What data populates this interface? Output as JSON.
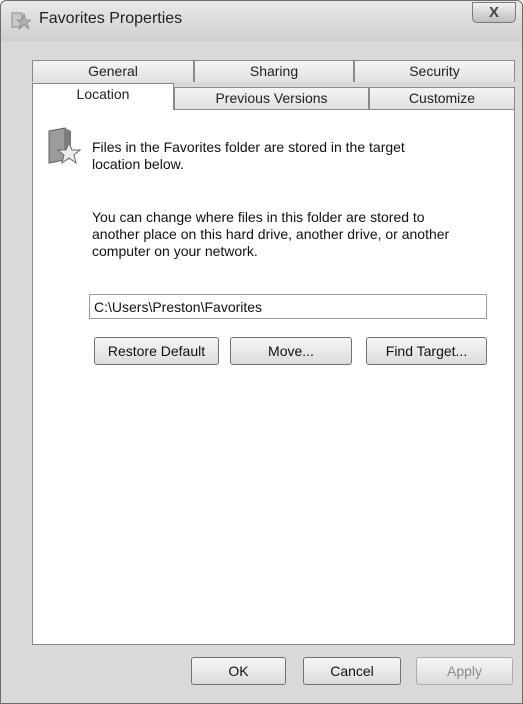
{
  "window": {
    "title": "Favorites Properties",
    "close_label": "X"
  },
  "tabs": {
    "back_row": [
      "General",
      "Sharing",
      "Security"
    ],
    "front_row": [
      "Location",
      "Previous Versions",
      "Customize"
    ],
    "active": "Location"
  },
  "location": {
    "intro_line1": "Files in the Favorites folder are stored in the target",
    "intro_line2": "location below.",
    "desc_line1": "You can change where files in this folder are stored to",
    "desc_line2": "another place on this hard drive, another drive, or another",
    "desc_line3": "computer on your network.",
    "path_value": "C:\\Users\\Preston\\Favorites",
    "restore_default_label": "Restore Default",
    "move_label": "Move...",
    "find_target_label": "Find Target..."
  },
  "footer": {
    "ok_label": "OK",
    "cancel_label": "Cancel",
    "apply_label": "Apply"
  }
}
